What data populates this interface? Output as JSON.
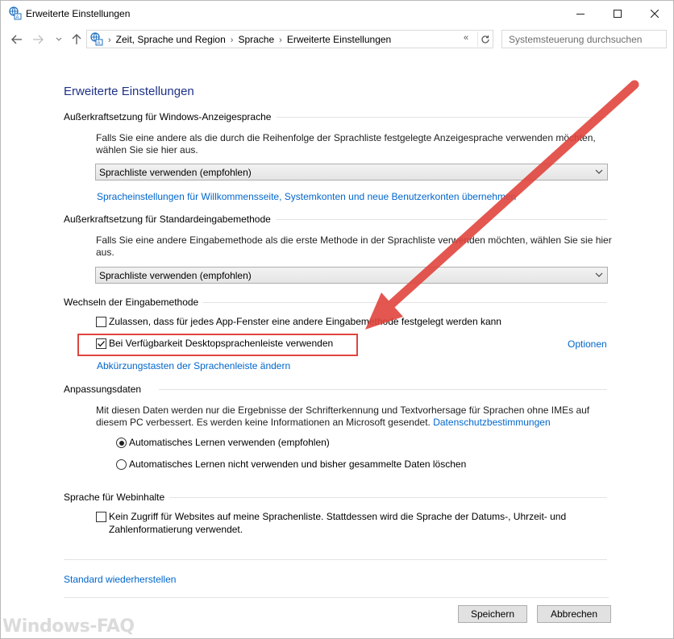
{
  "window": {
    "title": "Erweiterte Einstellungen",
    "icon": "language-globe-icon"
  },
  "address_bar": {
    "overflow": "«",
    "breadcrumbs": [
      "Zeit, Sprache und Region",
      "Sprache",
      "Erweiterte Einstellungen"
    ],
    "search_placeholder": "Systemsteuerung durchsuchen"
  },
  "page": {
    "heading": "Erweiterte Einstellungen",
    "display_language": {
      "label": "Außerkraftsetzung für Windows-Anzeigesprache",
      "desc_line1": "Falls Sie eine andere als die durch die Reihenfolge der Sprachliste festgelegte Anzeigesprache verwenden möchten,",
      "desc_line2": "wählen Sie sie hier aus.",
      "select_value": "Sprachliste verwenden (empfohlen)",
      "link": "Spracheinstellungen für Willkommensseite, Systemkonten und neue Benutzerkonten übernehmen"
    },
    "input_method": {
      "label": "Außerkraftsetzung für Standardeingabemethode",
      "desc_line1": "Falls Sie eine andere Eingabemethode als die erste Methode in der Sprachliste verwenden möchten, wählen Sie sie hier",
      "desc_line2": "aus.",
      "select_value": "Sprachliste verwenden (empfohlen)"
    },
    "switching": {
      "label": "Wechseln der Eingabemethode",
      "option1": {
        "label": "Zulassen, dass für jedes App-Fenster eine andere Eingabemethode festgelegt werden kann",
        "checked": false
      },
      "option2": {
        "label": "Bei Verfügbarkeit Desktopsprachenleiste verwenden",
        "checked": true
      },
      "options_link": "Optionen",
      "hotkeys_link": "Abkürzungstasten der Sprachenleiste ändern"
    },
    "personalization": {
      "label": "Anpassungsdaten",
      "desc_line1": "Mit diesen Daten werden nur die Ergebnisse der Schrifterkennung und Textvorhersage für Sprachen ohne IMEs auf",
      "desc_line2": "diesem PC verbessert. Es werden keine Informationen an Microsoft gesendet.",
      "privacy_link": "Datenschutzbestimmungen",
      "radio1": {
        "label": "Automatisches Lernen verwenden (empfohlen)",
        "selected": true
      },
      "radio2": {
        "label": "Automatisches Lernen nicht verwenden und bisher gesammelte Daten löschen",
        "selected": false
      }
    },
    "web_content": {
      "label": "Sprache für Webinhalte",
      "checkbox_line1": "Kein Zugriff für Websites auf meine Sprachenliste. Stattdessen wird die Sprache der Datums-, Uhrzeit- und",
      "checkbox_line2": "Zahlenformatierung verwendet.",
      "checked": false
    },
    "restore_link": "Standard wiederherstellen"
  },
  "buttons": {
    "save": "Speichern",
    "cancel": "Abbrechen"
  },
  "annotation": {
    "color": "#e0453e"
  },
  "watermark": "Windows-FAQ"
}
